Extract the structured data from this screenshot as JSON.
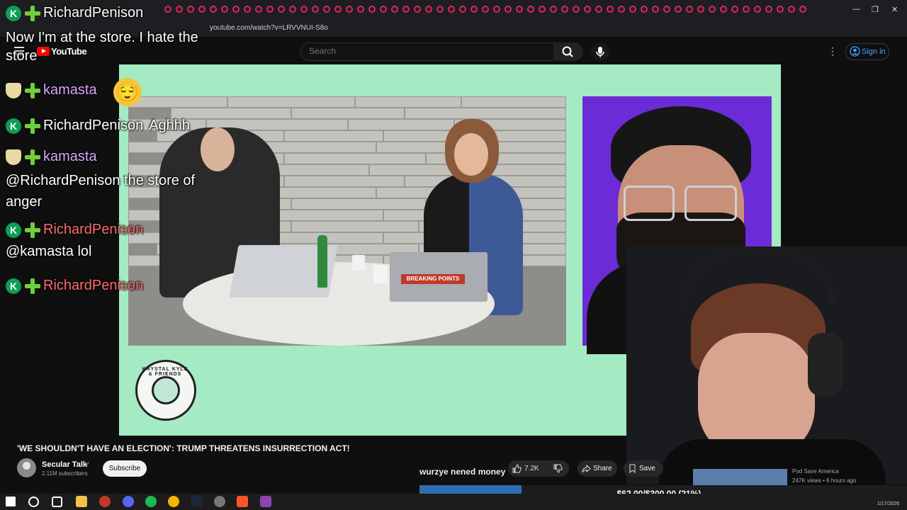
{
  "browser": {
    "url": "youtube.com/watch?v=LRVVNUI-S8o",
    "window_controls": {
      "minimize": "—",
      "maximize": "❐",
      "close": "✕"
    }
  },
  "youtube": {
    "logo_text": "YouTube",
    "search_placeholder": "Search",
    "sign_in": "Sign in"
  },
  "video": {
    "studio_sticker": "BREAKING POINTS",
    "logo_text": "KRYSTAL KYLE & FRIENDS",
    "title": "'WE SHOULDN'T HAVE AN ELECTION': TRUMP THREATENS INSURRECTION ACT!",
    "channel": "Secular Talk",
    "verified_icon": "✓",
    "subscribers": "2.11M subscribers",
    "subscribe_label": "Subscribe",
    "likes": "7.2K",
    "share_label": "Share",
    "save_label": "Save",
    "recommended": {
      "channel": "Pod Save America",
      "meta": "247K views • 6 hours ago"
    }
  },
  "stream_overlay": {
    "alert_text": "wurzye nened money",
    "goal": {
      "text": "$62.00/$300.00 (21%)",
      "fraction": 0.21
    },
    "chat": [
      {
        "user": "RichardPenison",
        "badges": [
          "k",
          "plus"
        ],
        "message": ""
      },
      {
        "user": "",
        "badges": [],
        "message": "Now I'm at the store. I hate the store"
      },
      {
        "user": "kamasta",
        "badges": [
          "pop",
          "plus"
        ],
        "message": ""
      },
      {
        "user": "RichardPenison",
        "badges": [
          "k",
          "plus"
        ],
        "message": "Aghhh"
      },
      {
        "user": "kamasta",
        "badges": [
          "pop",
          "plus"
        ],
        "message": ""
      },
      {
        "user": "",
        "badges": [],
        "message": "@RichardPenison the store of anger"
      },
      {
        "user": "RichardPenison",
        "badges": [
          "k",
          "plus"
        ],
        "message": ""
      },
      {
        "user": "",
        "badges": [],
        "message": "@kamasta lol"
      },
      {
        "user": "RichardPenison",
        "badges": [
          "k",
          "plus"
        ],
        "message": ""
      }
    ]
  },
  "taskbar": {
    "date": "1/17/2026"
  },
  "colors": {
    "video_bg": "#a4ebc4",
    "yt_red": "#ff0000",
    "link_blue": "#3ea6ff",
    "goal_fill": "#2d6fb3"
  }
}
